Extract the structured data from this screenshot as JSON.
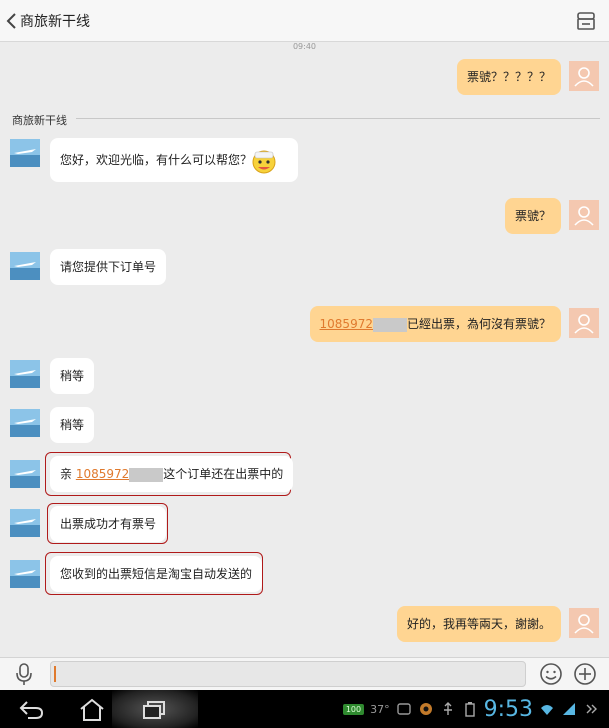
{
  "header": {
    "title": "商旅新干线"
  },
  "chat": {
    "timestamp": "09:40",
    "separator_label": "商旅新干线",
    "messages": [
      {
        "side": "right",
        "text": "票號？？？？？"
      },
      {
        "side": "left",
        "text": "您好，欢迎光临，有什么可以帮您？"
      },
      {
        "side": "right",
        "text": "票號？"
      },
      {
        "side": "left",
        "text": "请您提供下订单号"
      },
      {
        "side": "right",
        "link": "1085972",
        "text": "已經出票，為何沒有票號？"
      },
      {
        "side": "left",
        "text": "稍等"
      },
      {
        "side": "left",
        "text": "稍等"
      },
      {
        "side": "left",
        "prefix": "亲 ",
        "link": "1085972",
        "text": "这个订单还在出票中的"
      },
      {
        "side": "left",
        "text": "出票成功才有票号"
      },
      {
        "side": "left",
        "text": "您收到的出票短信是淘宝自动发送的"
      },
      {
        "side": "right",
        "text": "好的，我再等兩天，謝謝。"
      }
    ]
  },
  "status_bar": {
    "badge": "100",
    "temperature": "37°",
    "time": "9:53"
  },
  "colors": {
    "user_bubble": "#ffd592",
    "merchant_bubble": "#ffffff",
    "highlight": "#b01a1a",
    "link": "#e07a2e",
    "clock": "#58b7e3"
  }
}
